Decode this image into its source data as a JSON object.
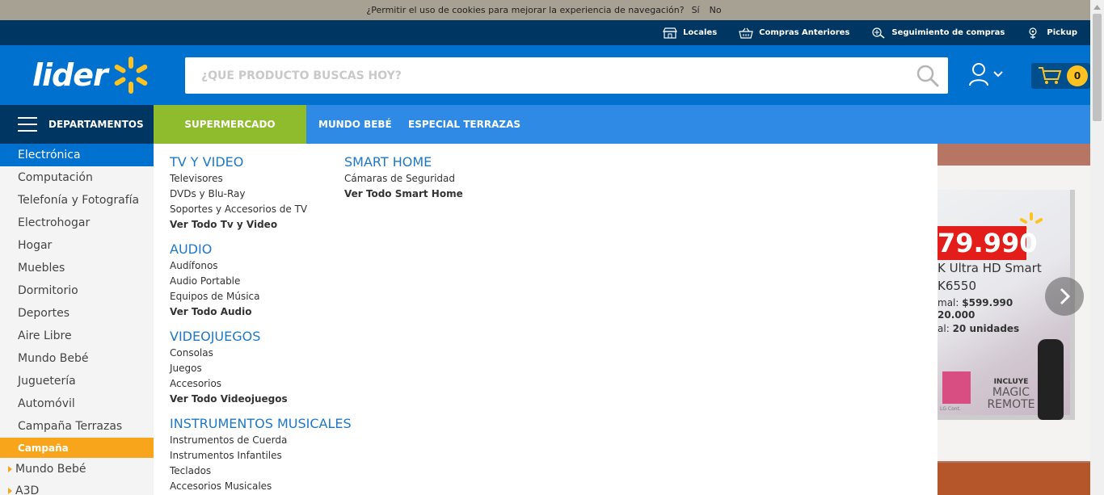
{
  "cookie_bar": {
    "text": "¿Permitir el uso de cookies para mejorar la experiencia de navegación?",
    "yes": "Sí",
    "no": "No"
  },
  "util_bar": {
    "items": [
      {
        "label": "Locales",
        "icon": "store-icon"
      },
      {
        "label": "Compras Anteriores",
        "icon": "basket-icon"
      },
      {
        "label": "Seguimiento de compras",
        "icon": "tracking-icon"
      },
      {
        "label": "Pickup",
        "icon": "pickup-icon"
      }
    ]
  },
  "header": {
    "logo_text": "lider",
    "search_placeholder": "¿QUÉ PRODUCTO BUSCAS HOY?",
    "cart_count": "0"
  },
  "nav": {
    "departments": "DEPARTAMENTOS",
    "supermercado": "SUPERMERCADO",
    "mundo_bebe": "MUNDO BEBÉ",
    "especial_terrazas": "ESPECIAL TERRAZAS"
  },
  "sidebar": {
    "items": [
      "Electrónica",
      "Computación",
      "Telefonía y Fotografía",
      "Electrohogar",
      "Hogar",
      "Muebles",
      "Dormitorio",
      "Deportes",
      "Aire Libre",
      "Mundo Bebé",
      "Juguetería",
      "Automóvil",
      "Campaña Terrazas"
    ],
    "campaign_heading": "Campaña",
    "campaign_items": [
      "Mundo Bebé",
      "A3D"
    ]
  },
  "mega_menu": {
    "col1": [
      {
        "title": "TV Y VIDEO",
        "links": [
          "Televisores",
          "DVDs y Blu-Ray",
          "Soportes y Accesorios de TV"
        ],
        "all": "Ver Todo Tv y Video"
      },
      {
        "title": "AUDIO",
        "links": [
          "Audífonos",
          "Audio Portable",
          "Equipos de Música"
        ],
        "all": "Ver Todo Audio"
      },
      {
        "title": "VIDEOJUEGOS",
        "links": [
          "Consolas",
          "Juegos",
          "Accesorios"
        ],
        "all": "Ver Todo Videojuegos"
      },
      {
        "title": "INSTRUMENTOS MUSICALES",
        "links": [
          "Instrumentos de Cuerda",
          "Instrumentos Infantiles",
          "Teclados",
          "Accesorios Musicales"
        ],
        "all": ""
      }
    ],
    "col2": [
      {
        "title": "SMART HOME",
        "links": [
          "Cámaras de Seguridad"
        ],
        "all": "Ver Todo Smart Home"
      }
    ]
  },
  "hero": {
    "price": "79.990",
    "line1": "K Ultra HD Smart",
    "line2": "K6550",
    "line3_label": "mal:",
    "line3_value": "$599.990",
    "line4": "20.000",
    "line5_label": "al:",
    "line5_value": "20 unidades",
    "badge_small": "INCLUYE",
    "badge_big1": "MAGIC",
    "badge_big2": "REMOTE",
    "brand_note": "LG Cont."
  },
  "colors": {
    "top_bar": "#003662",
    "header": "#0071ce",
    "nav": "#2f8ae6",
    "supermercado": "#8fbc2c",
    "accent_yellow": "#ffc220",
    "campaign_orange": "#f9a51c",
    "link_blue": "#1e78c8"
  }
}
